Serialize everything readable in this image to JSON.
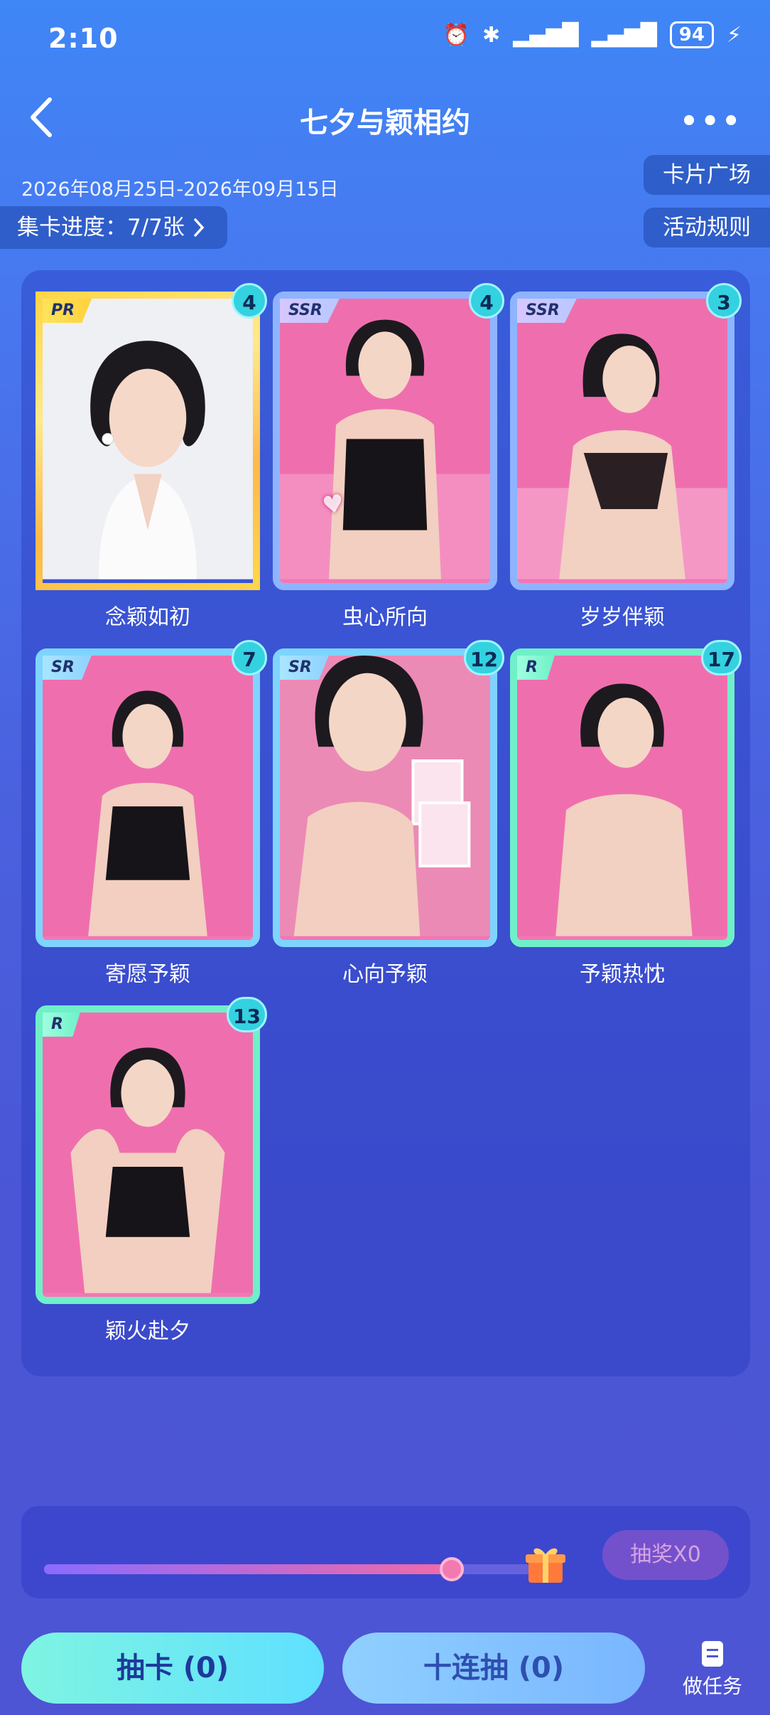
{
  "status_bar": {
    "time": "2:10",
    "battery": "94"
  },
  "header": {
    "title": "七夕与颖相约",
    "back_icon": "chevron-left-icon",
    "more_icon": "more-dots-icon"
  },
  "event": {
    "date_range": "2026年08月25日-2026年09月15日",
    "progress_label": "集卡进度：7/7张",
    "card_plaza": "卡片广场",
    "rules": "活动规则"
  },
  "cards": [
    {
      "name": "念颖如初",
      "rarity": "PR",
      "count": "4"
    },
    {
      "name": "虫心所向",
      "rarity": "SSR",
      "count": "4"
    },
    {
      "name": "岁岁伴颖",
      "rarity": "SSR",
      "count": "3"
    },
    {
      "name": "寄愿予颖",
      "rarity": "SR",
      "count": "7"
    },
    {
      "name": "心向予颖",
      "rarity": "SR",
      "count": "12"
    },
    {
      "name": "予颖热忱",
      "rarity": "R",
      "count": "17"
    },
    {
      "name": "颖火赴夕",
      "rarity": "R",
      "count": "13"
    }
  ],
  "reward": {
    "progress": 0.82,
    "lottery_label": "抽奖X0"
  },
  "actions": {
    "draw": "抽卡 (0)",
    "draw10": "十连抽 (0)",
    "task": "做任务"
  },
  "colors": {
    "accent": "#34d1e0",
    "pink": "#f277b3",
    "draw_button": "#7ff4e2"
  }
}
